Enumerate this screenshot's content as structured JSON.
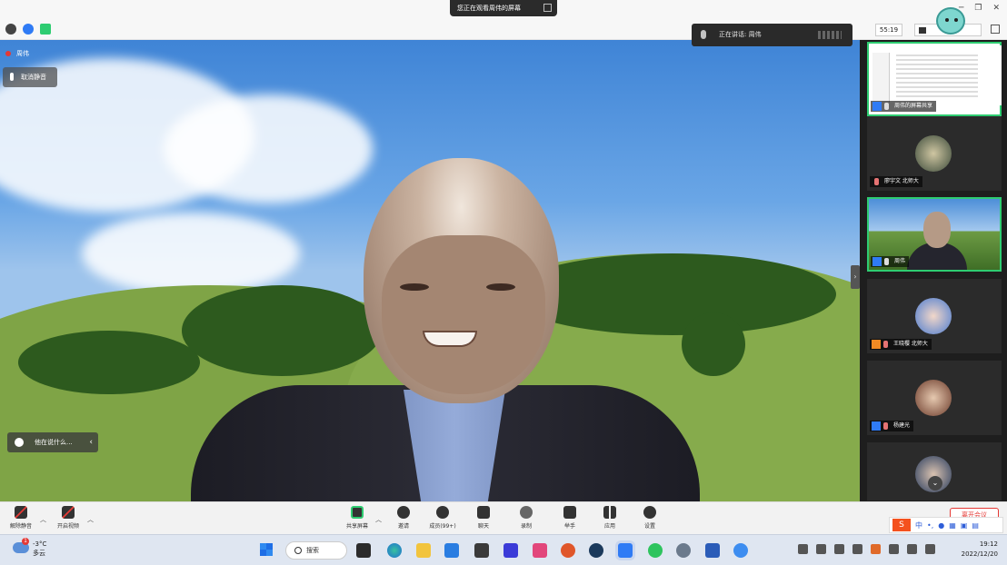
{
  "topbar": {
    "share_banner": "您正在观看周伟的屏幕",
    "speaking": "正在讲话: 周伟",
    "timer": "55:19",
    "window_controls": [
      "─",
      "❐",
      "✕"
    ]
  },
  "main_video": {
    "self_name": "周伟",
    "unmute_label": "取消静音",
    "caption_label": "他在说什么..."
  },
  "sidebar": {
    "tiles": [
      {
        "name": "周伟的屏幕共享"
      },
      {
        "name": "廖宇文 北师大"
      },
      {
        "name": "周伟"
      },
      {
        "name": "王晓樱 北师大"
      },
      {
        "name": "杨建光"
      },
      {
        "name": ""
      }
    ]
  },
  "toolbar": {
    "unmute": "解除静音",
    "start_video": "开启视频",
    "share_screen": "共享屏幕",
    "invite": "邀请",
    "members": "成员(99+)",
    "chat": "聊天",
    "record": "录制",
    "raise_hand": "举手",
    "apps": "应用",
    "settings": "设置",
    "end_meeting": "离开会议",
    "ime": {
      "logo": "S",
      "lang": "中"
    }
  },
  "taskbar": {
    "temperature": "-3°C",
    "weather": "多云",
    "weather_badge": "1",
    "search": "搜索",
    "time": "19:12",
    "date": "2022/12/20"
  },
  "colors": {
    "accent_green": "#2ecc71",
    "danger_red": "#e53935",
    "user_blue": "#2f7bf5",
    "user_orange": "#f08a24"
  }
}
